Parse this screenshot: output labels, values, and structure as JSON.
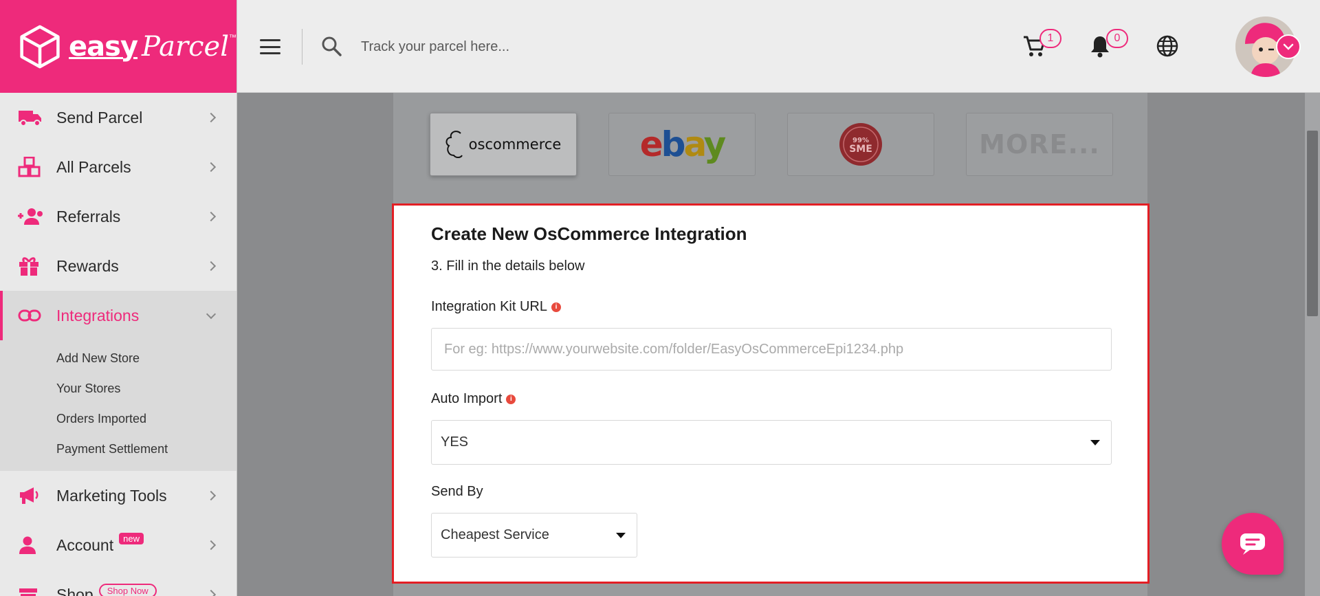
{
  "brand": {
    "name_part1": "easy",
    "name_part2": "Parcel",
    "tm": "™"
  },
  "topbar": {
    "search_placeholder": "Track your parcel here...",
    "cart_count": "1",
    "notification_count": "0"
  },
  "sidebar": {
    "items": [
      {
        "label": "Send Parcel"
      },
      {
        "label": "All Parcels"
      },
      {
        "label": "Referrals"
      },
      {
        "label": "Rewards"
      },
      {
        "label": "Integrations"
      },
      {
        "label": "Marketing Tools"
      },
      {
        "label": "Account",
        "badge": "new"
      },
      {
        "label": "Shop",
        "badge": "Shop Now"
      }
    ],
    "integrations_sub": [
      {
        "label": "Add New Store"
      },
      {
        "label": "Your Stores"
      },
      {
        "label": "Orders Imported"
      },
      {
        "label": "Payment Settlement"
      }
    ]
  },
  "platforms": [
    {
      "name": "oscommerce"
    },
    {
      "name": "ebay"
    },
    {
      "name": "99% SME"
    },
    {
      "name": "MORE..."
    }
  ],
  "form": {
    "title": "Create New OsCommerce Integration",
    "step": "3. Fill in the details below",
    "kit_url_label": "Integration Kit URL",
    "kit_url_placeholder": "For eg: https://www.yourwebsite.com/folder/EasyOsCommerceEpi1234.php",
    "auto_import_label": "Auto Import",
    "auto_import_value": "YES",
    "send_by_label": "Send By",
    "send_by_value": "Cheapest Service"
  },
  "colors": {
    "brand": "#ee2a7b",
    "highlight_border": "#e31e24"
  }
}
